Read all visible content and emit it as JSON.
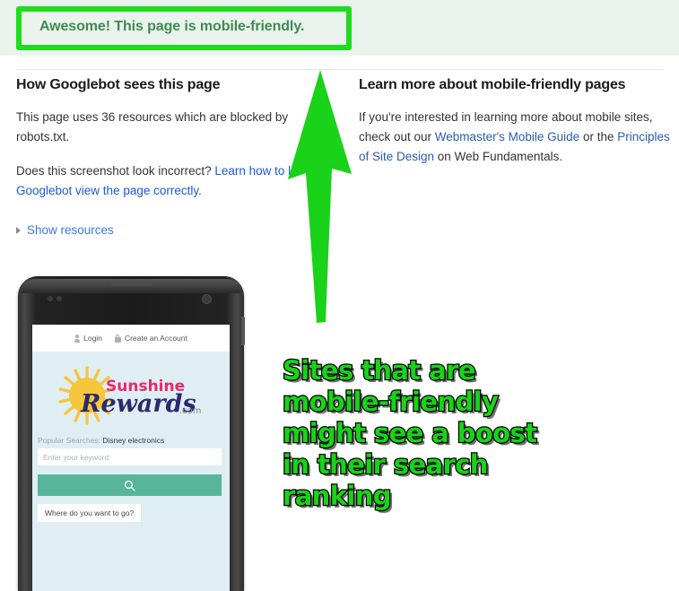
{
  "banner": {
    "message": "Awesome! This page is mobile-friendly.",
    "background_color": "#eaf3ec",
    "text_color": "#3f8a55",
    "highlight_color": "#1ddd1d"
  },
  "columns": {
    "left": {
      "heading": "How Googlebot sees this page",
      "paragraph1": "This page uses 36 resources which are blocked by robots.txt.",
      "paragraph2_prefix": "Does this screenshot look incorrect? ",
      "paragraph2_link": "Learn how to let Googlebot view the page correctly.",
      "show_resources_label": "Show resources"
    },
    "right": {
      "heading": "Learn more about mobile-friendly pages",
      "paragraph_prefix": "If you're interested in learning more about mobile sites, check out our ",
      "link1": "Webmaster's Mobile Guide",
      "paragraph_middle": " or the ",
      "link2": "Principles of Site Design",
      "paragraph_suffix": " on Web Fundamentals."
    }
  },
  "annotation": {
    "lines": [
      "Sites that are",
      "mobile-friendly",
      "might see a boost",
      "in their search",
      "ranking"
    ],
    "fill_color": "#19d219",
    "stroke_color": "#000000",
    "arrow_color": "#19d219"
  },
  "phone_preview": {
    "nav": {
      "login_label": "Login",
      "create_account_label": "Create an Account"
    },
    "logo": {
      "word1": "Sunshine",
      "word2": "Rewards",
      "suffix": ".com",
      "word1_color": "#e8296b",
      "word2_color": "#2b2a6e",
      "sun_color": "#f6c63c"
    },
    "search": {
      "popular_searches_label": "Popular Searches:",
      "popular_terms": "Disney  electronics",
      "input_placeholder": "Enter your keyword",
      "button_icon": "search-icon",
      "button_color": "#57b59a",
      "prompt_pill": "Where do you want to go?"
    }
  }
}
